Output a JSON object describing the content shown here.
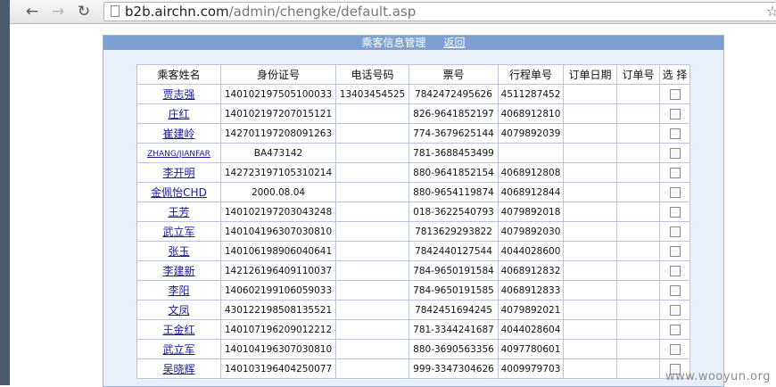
{
  "browser": {
    "url_host": "b2b.airchn.com",
    "url_path": "/admin/chengke/default.asp",
    "back_icon": "←",
    "forward_icon": "→",
    "reload_icon": "↻",
    "star_icon": "☆"
  },
  "panel": {
    "title": "乘客信息管理",
    "back_link": "返回"
  },
  "table": {
    "headers": [
      "乘客姓名",
      "身份证号",
      "电话号码",
      "票号",
      "行程单号",
      "订单日期",
      "订单号",
      "选 择"
    ],
    "rows": [
      {
        "name": "贾志强",
        "id": "140102197505100033",
        "phone": "13403454525",
        "ticket": "7842472495626",
        "itinerary": "4511287452",
        "order_date": "",
        "order_no": ""
      },
      {
        "name": "庄红",
        "id": "140102197207015121",
        "phone": "",
        "ticket": "826-9641852197",
        "itinerary": "4068912810",
        "order_date": "",
        "order_no": ""
      },
      {
        "name": "崔建岭",
        "id": "142701197208091263",
        "phone": "",
        "ticket": "774-3679625144",
        "itinerary": "4079892039",
        "order_date": "",
        "order_no": ""
      },
      {
        "name": "ZHANG/JIANFAR",
        "id": "BA473142",
        "phone": "",
        "ticket": "781-3688453499",
        "itinerary": "",
        "order_date": "",
        "order_no": ""
      },
      {
        "name": "李开明",
        "id": "142723197105310214",
        "phone": "",
        "ticket": "880-9641852154",
        "itinerary": "4068912808",
        "order_date": "",
        "order_no": ""
      },
      {
        "name": "金佩怡CHD",
        "id": "2000.08.04",
        "phone": "",
        "ticket": "880-9654119874",
        "itinerary": "4068912844",
        "order_date": "",
        "order_no": ""
      },
      {
        "name": "王芳",
        "id": "140102197203043248",
        "phone": "",
        "ticket": "018-3622540793",
        "itinerary": "4079892018",
        "order_date": "",
        "order_no": ""
      },
      {
        "name": "武立军",
        "id": "140104196307030810",
        "phone": "",
        "ticket": "7813629293822",
        "itinerary": "4079892030",
        "order_date": "",
        "order_no": ""
      },
      {
        "name": "张玉",
        "id": "140106198906040641",
        "phone": "",
        "ticket": "7842440127544",
        "itinerary": "4044028600",
        "order_date": "",
        "order_no": ""
      },
      {
        "name": "李建新",
        "id": "142126196409110037",
        "phone": "",
        "ticket": "784-9650191584",
        "itinerary": "4068912832",
        "order_date": "",
        "order_no": ""
      },
      {
        "name": "李阳",
        "id": "140602199106059033",
        "phone": "",
        "ticket": "784-9650191585",
        "itinerary": "4068912833",
        "order_date": "",
        "order_no": ""
      },
      {
        "name": "文凤",
        "id": "430122198508135521",
        "phone": "",
        "ticket": "7842451694245",
        "itinerary": "4079892021",
        "order_date": "",
        "order_no": ""
      },
      {
        "name": "王金红",
        "id": "140107196209012212",
        "phone": "",
        "ticket": "781-3344241687",
        "itinerary": "4044028604",
        "order_date": "",
        "order_no": ""
      },
      {
        "name": "武立军",
        "id": "140104196307030810",
        "phone": "",
        "ticket": "880-3690563356",
        "itinerary": "4097780601",
        "order_date": "",
        "order_no": ""
      },
      {
        "name": "吴晓辉",
        "id": "140103196404250077",
        "phone": "",
        "ticket": "999-3347304626",
        "itinerary": "4009979703",
        "order_date": "",
        "order_no": ""
      }
    ]
  },
  "watermark": "www.wooyun.org",
  "colors": {
    "header_bg": "#7fa0d2",
    "panel_bg": "#e9f0fb",
    "grid_border": "#b7c6de",
    "link": "#1a1a9a"
  }
}
